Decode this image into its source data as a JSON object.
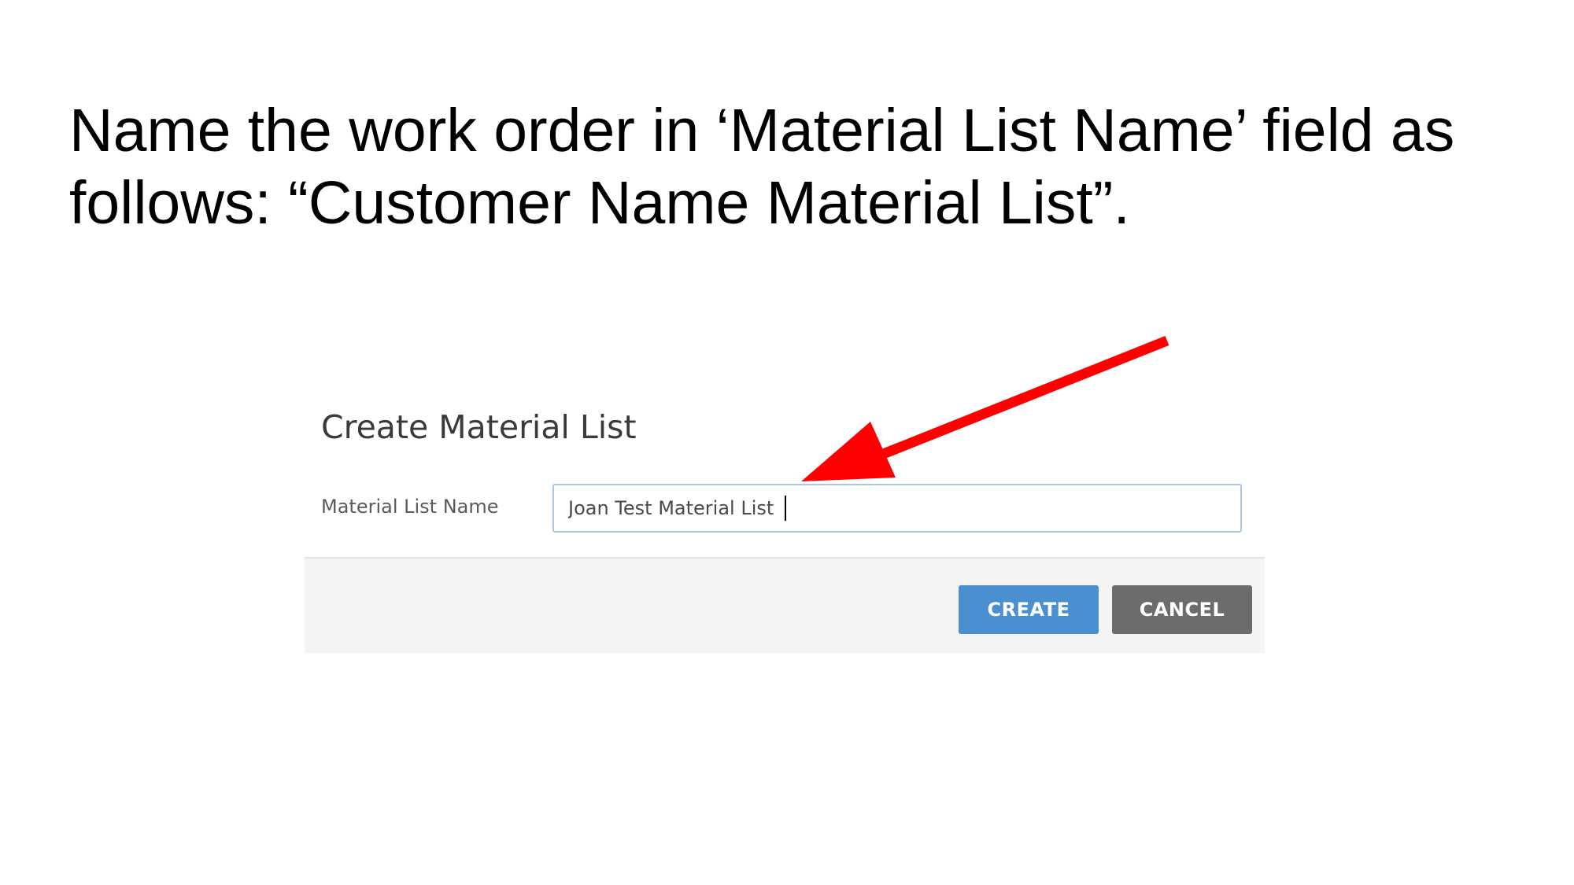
{
  "instruction": {
    "text": "Name the work order in ‘Material List Name’ field as follows: “Customer Name Material List”."
  },
  "dialog": {
    "title": "Create Material List",
    "field_label": "Material List Name",
    "field_value": "Joan Test Material List",
    "create_label": "CREATE",
    "cancel_label": "CANCEL"
  },
  "colors": {
    "annotation_arrow": "#ff0000",
    "create_button": "#4a90d0",
    "cancel_button": "#6c6c6c",
    "footer_background": "#f4f4f4"
  },
  "icons": {
    "annotation": "arrow-pointer-icon"
  }
}
